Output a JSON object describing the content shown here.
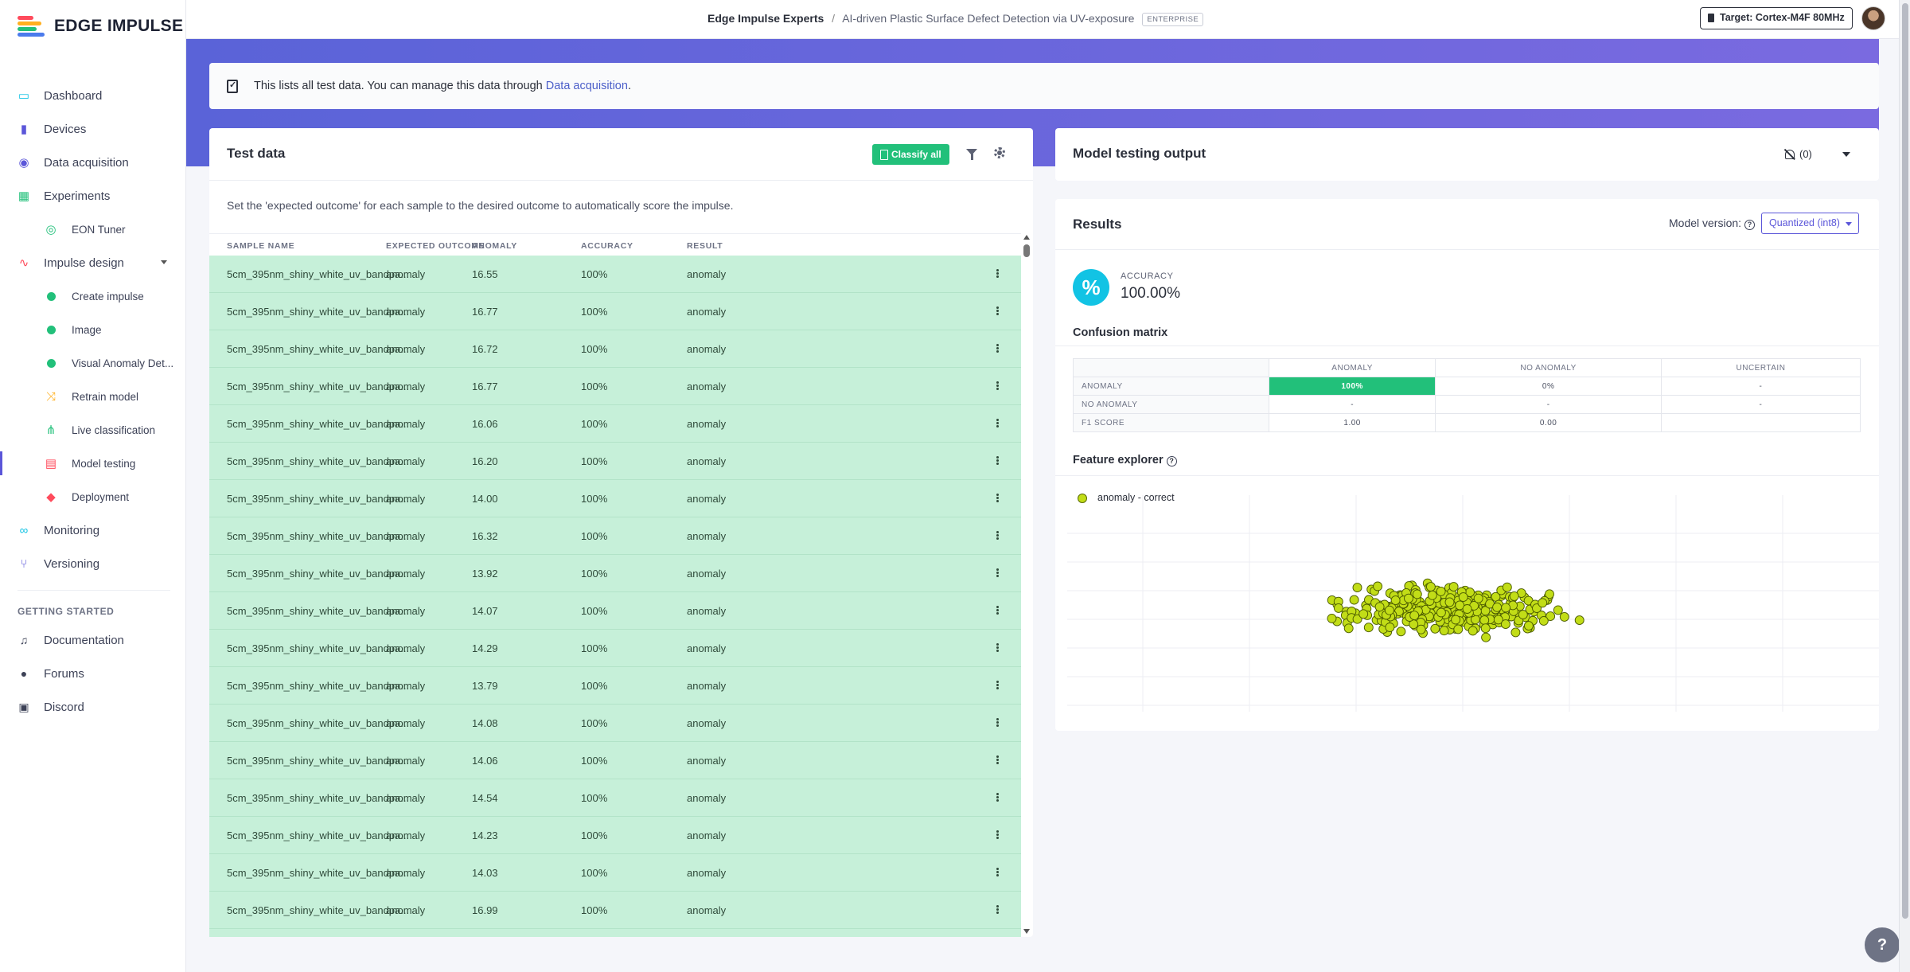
{
  "brand": {
    "name": "EDGE IMPULSE",
    "colors": [
      "#ff4b5c",
      "#ffb020",
      "#22c07a",
      "#4b7bec"
    ]
  },
  "header": {
    "org": "Edge Impulse Experts",
    "separator": "/",
    "project": "AI-driven Plastic Surface Defect Detection via UV-exposure",
    "badge": "ENTERPRISE",
    "target": "Target: Cortex-M4F 80MHz"
  },
  "sidebar": {
    "items": [
      {
        "label": "Dashboard",
        "icon": "monitor-icon",
        "color": "#12c3e4"
      },
      {
        "label": "Devices",
        "icon": "device-icon",
        "color": "#5b56d9"
      },
      {
        "label": "Data acquisition",
        "icon": "database-icon",
        "color": "#5b56d9"
      },
      {
        "label": "Experiments",
        "icon": "grid-icon",
        "color": "#22c07a"
      },
      {
        "label": "EON Tuner",
        "icon": "compass-icon",
        "color": "#22c07a"
      },
      {
        "label": "Impulse design",
        "icon": "pulse-icon",
        "color": "#ff4b5c"
      },
      {
        "label": "Create impulse",
        "icon": "dot-icon",
        "color": "#22c07a"
      },
      {
        "label": "Image",
        "icon": "dot-icon",
        "color": "#22c07a"
      },
      {
        "label": "Visual Anomaly Det...",
        "icon": "dot-icon",
        "color": "#22c07a"
      },
      {
        "label": "Retrain model",
        "icon": "shuffle-icon",
        "color": "#ffb020"
      },
      {
        "label": "Live classification",
        "icon": "network-icon",
        "color": "#22c07a"
      },
      {
        "label": "Model testing",
        "icon": "clipboard-icon",
        "color": "#ff4b5c"
      },
      {
        "label": "Deployment",
        "icon": "cube-icon",
        "color": "#ff4b5c"
      },
      {
        "label": "Monitoring",
        "icon": "binoculars-icon",
        "color": "#12c3e4"
      },
      {
        "label": "Versioning",
        "icon": "branch-icon",
        "color": "#5b56d9"
      }
    ],
    "section": "GETTING STARTED",
    "help_items": [
      {
        "label": "Documentation",
        "icon": "doc-icon"
      },
      {
        "label": "Forums",
        "icon": "forum-icon"
      },
      {
        "label": "Discord",
        "icon": "discord-icon"
      }
    ]
  },
  "banner": {
    "text": "This lists all test data. You can manage this data through ",
    "link": "Data acquisition",
    "suffix": "."
  },
  "test_data": {
    "title": "Test data",
    "classify_label": "Classify all",
    "hint": "Set the 'expected outcome' for each sample to the desired outcome to automatically score the impulse.",
    "columns": [
      "SAMPLE NAME",
      "EXPECTED OUTCOME",
      "ANOMALY",
      "ACCURACY",
      "RESULT"
    ],
    "rows": [
      [
        "5cm_395nm_shiny_white_uv_bandpa...",
        "anomaly",
        "16.55",
        "100%",
        "anomaly"
      ],
      [
        "5cm_395nm_shiny_white_uv_bandpa...",
        "anomaly",
        "16.77",
        "100%",
        "anomaly"
      ],
      [
        "5cm_395nm_shiny_white_uv_bandpa...",
        "anomaly",
        "16.72",
        "100%",
        "anomaly"
      ],
      [
        "5cm_395nm_shiny_white_uv_bandpa...",
        "anomaly",
        "16.77",
        "100%",
        "anomaly"
      ],
      [
        "5cm_395nm_shiny_white_uv_bandpa...",
        "anomaly",
        "16.06",
        "100%",
        "anomaly"
      ],
      [
        "5cm_395nm_shiny_white_uv_bandpa...",
        "anomaly",
        "16.20",
        "100%",
        "anomaly"
      ],
      [
        "5cm_395nm_shiny_white_uv_bandpa...",
        "anomaly",
        "14.00",
        "100%",
        "anomaly"
      ],
      [
        "5cm_395nm_shiny_white_uv_bandpa...",
        "anomaly",
        "16.32",
        "100%",
        "anomaly"
      ],
      [
        "5cm_395nm_shiny_white_uv_bandpa...",
        "anomaly",
        "13.92",
        "100%",
        "anomaly"
      ],
      [
        "5cm_395nm_shiny_white_uv_bandpa...",
        "anomaly",
        "14.07",
        "100%",
        "anomaly"
      ],
      [
        "5cm_395nm_shiny_white_uv_bandpa...",
        "anomaly",
        "14.29",
        "100%",
        "anomaly"
      ],
      [
        "5cm_395nm_shiny_white_uv_bandpa...",
        "anomaly",
        "13.79",
        "100%",
        "anomaly"
      ],
      [
        "5cm_395nm_shiny_white_uv_bandpa...",
        "anomaly",
        "14.08",
        "100%",
        "anomaly"
      ],
      [
        "5cm_395nm_shiny_white_uv_bandpa...",
        "anomaly",
        "14.06",
        "100%",
        "anomaly"
      ],
      [
        "5cm_395nm_shiny_white_uv_bandpa...",
        "anomaly",
        "14.54",
        "100%",
        "anomaly"
      ],
      [
        "5cm_395nm_shiny_white_uv_bandpa...",
        "anomaly",
        "14.23",
        "100%",
        "anomaly"
      ],
      [
        "5cm_395nm_shiny_white_uv_bandpa...",
        "anomaly",
        "14.03",
        "100%",
        "anomaly"
      ],
      [
        "5cm_395nm_shiny_white_uv_bandpa...",
        "anomaly",
        "16.99",
        "100%",
        "anomaly"
      ]
    ]
  },
  "output": {
    "title": "Model testing output",
    "notifications": "(0)"
  },
  "results": {
    "title": "Results",
    "model_version_label": "Model version:",
    "model_version_value": "Quantized (int8)",
    "accuracy_label": "ACCURACY",
    "accuracy_value": "100.00%",
    "accuracy_symbol": "%",
    "confusion_title": "Confusion matrix",
    "confusion": {
      "columns": [
        "ANOMALY",
        "NO ANOMALY",
        "UNCERTAIN"
      ],
      "rows": [
        {
          "label": "ANOMALY",
          "values": [
            "100%",
            "0%",
            "-"
          ]
        },
        {
          "label": "NO ANOMALY",
          "values": [
            "-",
            "-",
            "-"
          ]
        },
        {
          "label": "F1 SCORE",
          "values": [
            "1.00",
            "0.00",
            ""
          ]
        }
      ]
    },
    "feature_title": "Feature explorer",
    "legend": "anomaly - correct",
    "point_color": "#c2dd17"
  },
  "help_label": "?"
}
